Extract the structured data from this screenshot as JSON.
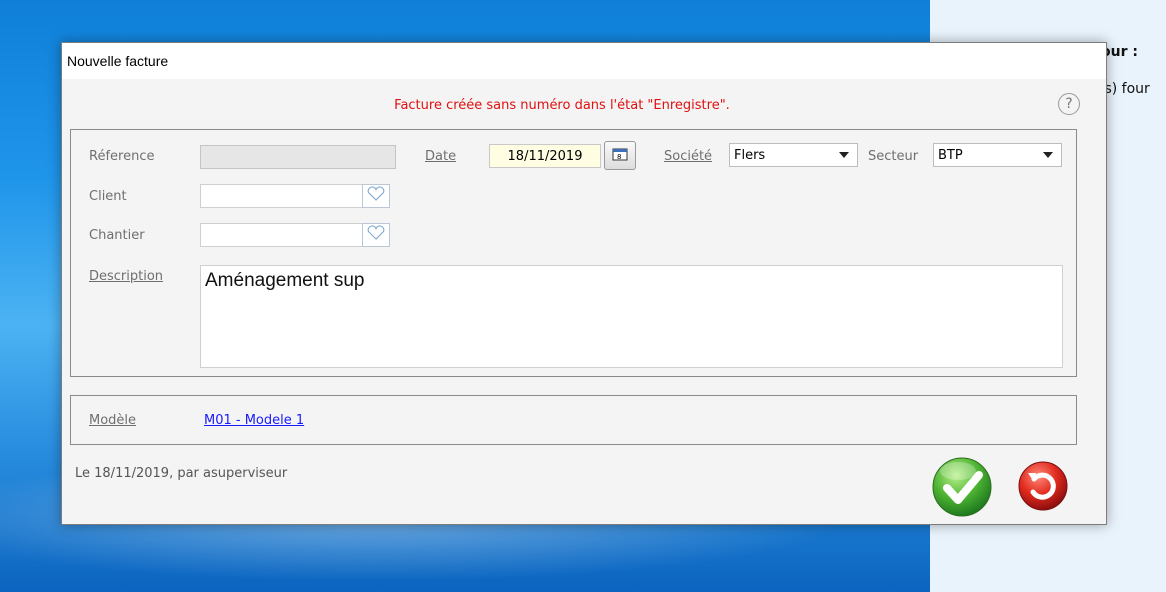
{
  "background": {
    "right_text_1": "our :",
    "right_text_2": "(s) four"
  },
  "dialog": {
    "title": "Nouvelle facture",
    "status_message": "Facture créée sans numéro dans l'état \"Enregistre\".",
    "help_icon_symbol": "?",
    "fields": {
      "reference_label": "Réference",
      "reference_value": "",
      "date_label": "Date",
      "date_value": "18/11/2019",
      "societe_label": "Société",
      "societe_value": "Flers",
      "secteur_label": "Secteur",
      "secteur_value": "BTP",
      "client_label": "Client",
      "client_value": "",
      "chantier_label": "Chantier",
      "chantier_value": "",
      "description_label": "Description",
      "description_value": "Aménagement sup"
    },
    "modele": {
      "label": "Modèle",
      "link": "M01 - Modele 1"
    },
    "footer_text": "Le 18/11/2019, par asuperviseur"
  },
  "colors": {
    "status_red": "#e01010",
    "link_blue": "#1a1aff",
    "date_bg": "#fffde2",
    "ok_green": "#3aa53a",
    "cancel_red": "#d61e1e"
  },
  "icons": {
    "help": "help-icon",
    "calendar": "calendar-icon",
    "heart": "heart-icon",
    "ok": "check-icon",
    "cancel": "undo-icon"
  }
}
